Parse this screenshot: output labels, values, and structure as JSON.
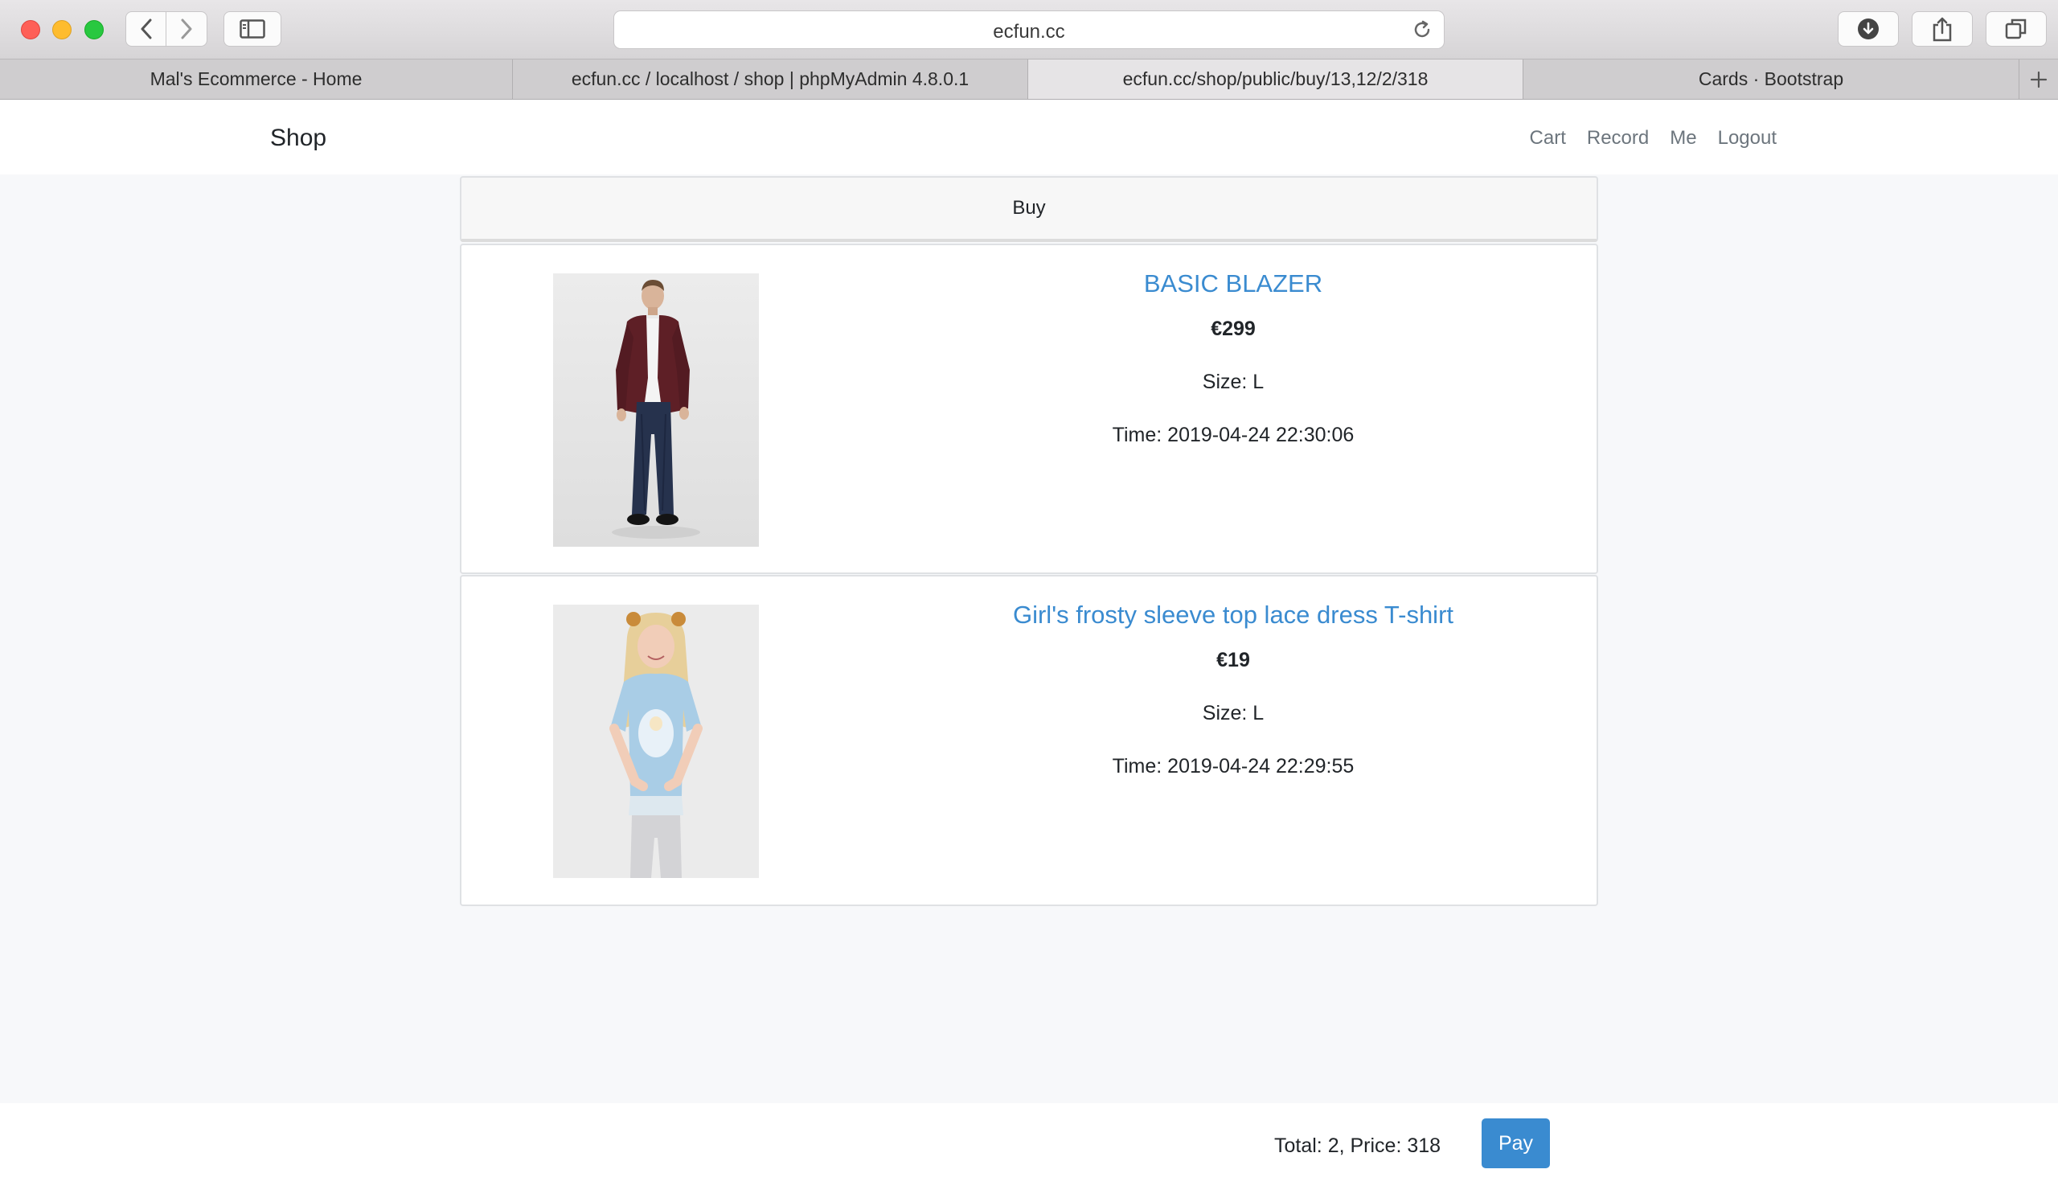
{
  "browser": {
    "address": "ecfun.cc",
    "tabs": [
      {
        "label": "Mal's Ecommerce - Home"
      },
      {
        "label": "ecfun.cc / localhost / shop | phpMyAdmin 4.8.0.1"
      },
      {
        "label": "ecfun.cc/shop/public/buy/13,12/2/318"
      },
      {
        "label": "Cards · Bootstrap"
      }
    ]
  },
  "navbar": {
    "brand": "Shop",
    "links": {
      "cart": "Cart",
      "record": "Record",
      "me": "Me",
      "logout": "Logout"
    }
  },
  "card_header": "Buy",
  "items": [
    {
      "title": "BASIC BLAZER",
      "price": "€299",
      "size": "Size: L",
      "time": "Time: 2019-04-24 22:30:06"
    },
    {
      "title": "Girl's frosty sleeve top lace dress T-shirt",
      "price": "€19",
      "size": "Size: L",
      "time": "Time: 2019-04-24 22:29:55"
    }
  ],
  "footer": {
    "summary": "Total: 2, Price: 318",
    "pay_label": "Pay"
  },
  "colors": {
    "accent": "#3a8bd0",
    "page_background": "#f7f8fa"
  }
}
